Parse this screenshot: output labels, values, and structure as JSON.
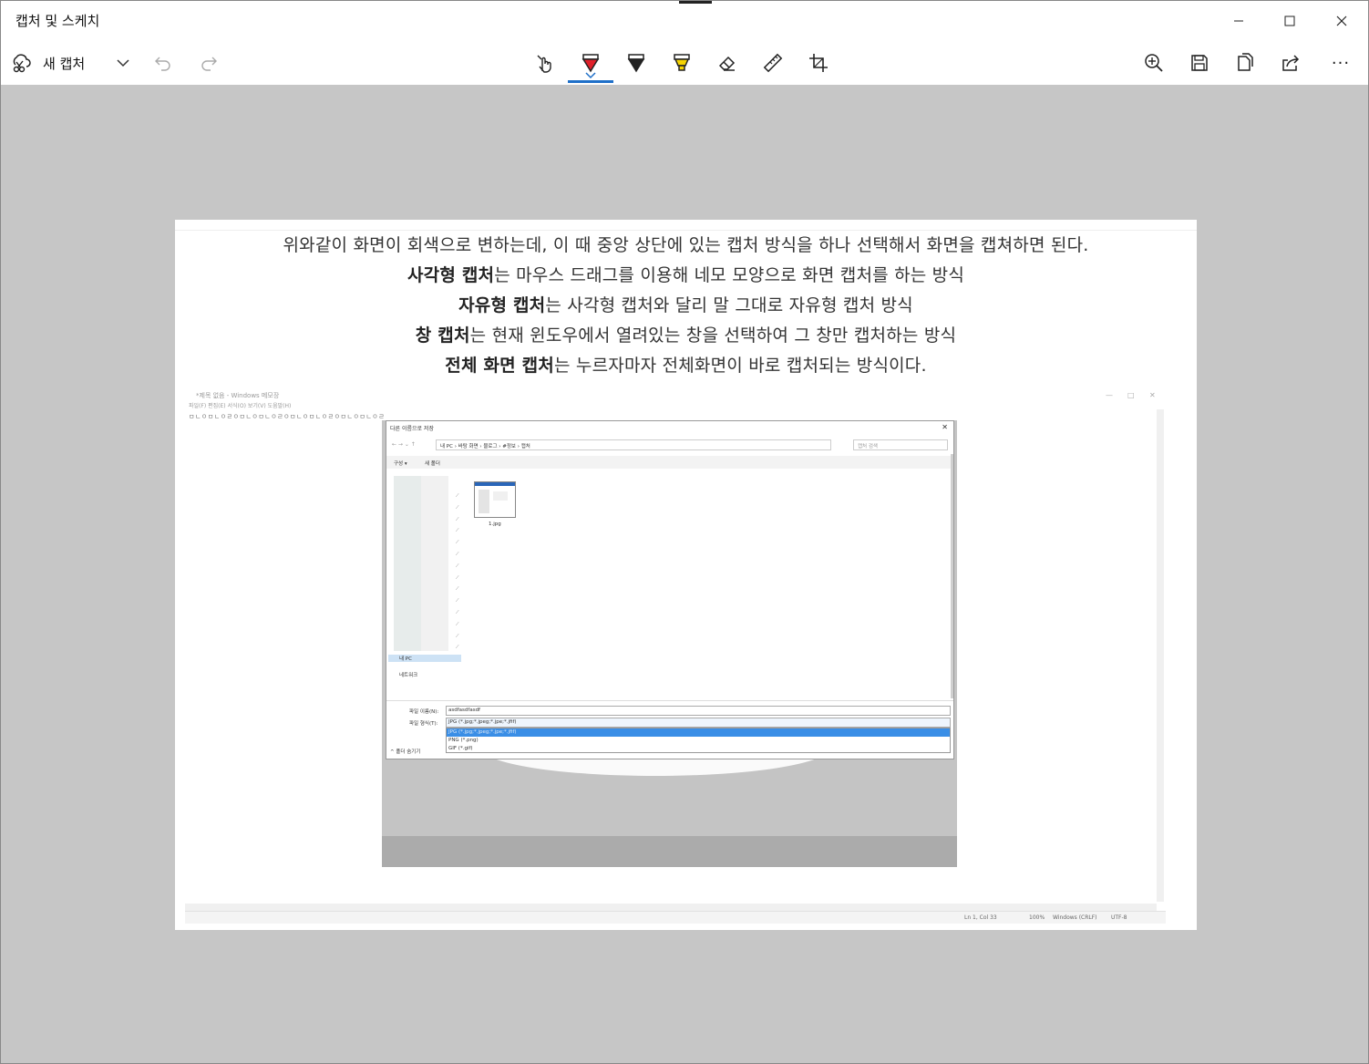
{
  "window": {
    "title": "캡처 및 스케치",
    "controls": {
      "minimize": "minimize",
      "maximize": "maximize",
      "close": "close"
    }
  },
  "toolbar": {
    "new_capture_label": "새 캡처",
    "tools": [
      "touch-writing",
      "ballpoint-pen",
      "pencil",
      "highlighter",
      "eraser",
      "ruler",
      "crop"
    ],
    "active_tool": "ballpoint-pen",
    "right_tools": [
      "zoom",
      "save",
      "copy",
      "share",
      "more"
    ],
    "more_label": "···"
  },
  "document": {
    "line1": "위와같이 화면이 회색으로 변하는데, 이 때 중앙 상단에 있는 캡처 방식을 하나 선택해서 화면을 캡쳐하면 된다.",
    "line2_bold": "사각형 캡처",
    "line2_rest": "는 마우스 드래그를 이용해 네모 모양으로 화면 캡처를 하는 방식",
    "line3_bold": "자유형 캡처",
    "line3_rest": "는 사각형 캡처와 달리 말 그대로 자유형 캡처 방식",
    "line4_bold": "창 캡처",
    "line4_rest": "는 현재 윈도우에서 열려있는 창을 선택하여 그 창만 캡처하는 방식",
    "line5_bold": "전체 화면 캡처",
    "line5_rest": "는 누르자마자 전체화면이 바로 캡처되는 방식이다."
  },
  "embedded": {
    "notepad_title": "*제목 없음 - Windows 메모장",
    "notepad_menu": "파일(F)  편집(E)  서식(O)  보기(V)  도움말(H)",
    "typed_text": "ㅁㄴㅇㅁㄴㅇㄹㅇㅁㄴㅇㅁㄴㅇㄹㅇㅁㄴㅇㅁㄴㅇㄹㅇㅁㄴㅇㅁㄴㅇㄹ",
    "status": {
      "position": "Ln 1, Col 33",
      "zoom": "100%",
      "eol": "Windows (CRLF)",
      "encoding": "UTF-8"
    },
    "dialog": {
      "title": "다른 이름으로 저장",
      "path": [
        "내 PC",
        "바탕 화면",
        "블로그",
        "#정보",
        "캡처"
      ],
      "search_placeholder": "캡처 검색",
      "organize": "구성 ▾",
      "new_folder": "새 폴더",
      "file_name": "1.jpg",
      "nav_this_pc": "내 PC",
      "nav_network": "네트워크",
      "filename_label": "파일 이름(N):",
      "filename_value": "asdfasdfasdf",
      "filetype_label": "파일 형식(T):",
      "filetype_value": "JPG (*.jpg;*.jpeg;*.jpe;*.jfif)",
      "filetype_options": [
        "JPG (*.jpg;*.jpeg;*.jpe;*.jfif)",
        "PNG (*.png)",
        "GIF (*.gif)"
      ],
      "hide_folders": "^ 폴더 숨기기"
    }
  }
}
